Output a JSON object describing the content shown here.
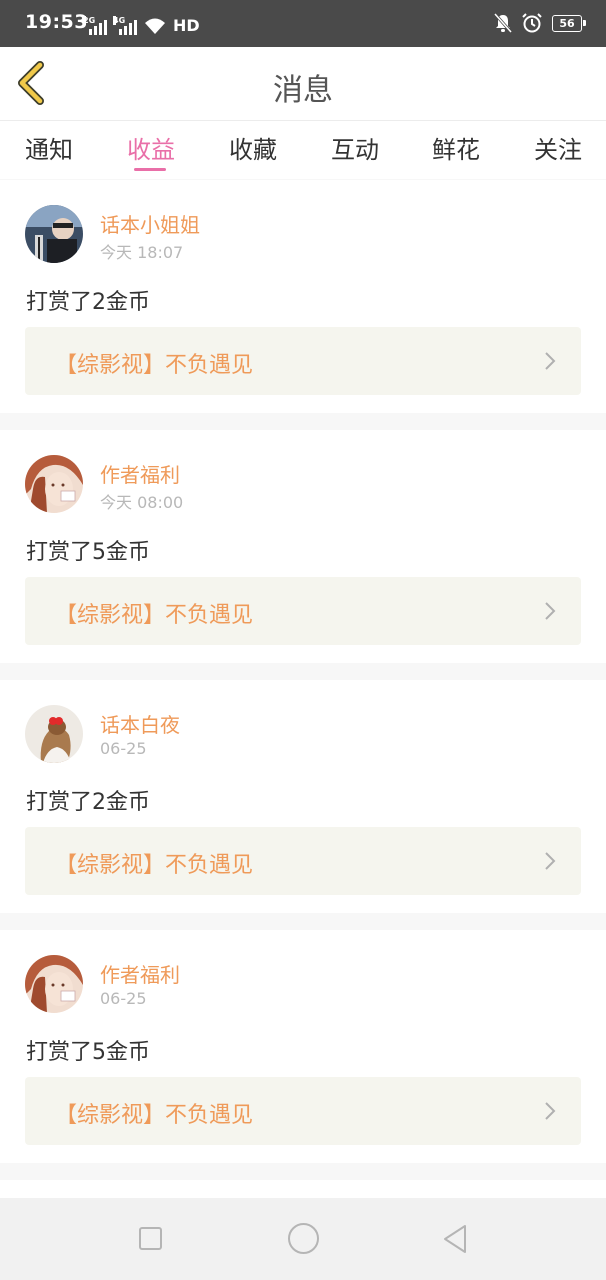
{
  "status_bar": {
    "time": "19:53",
    "network_1": "2G",
    "network_2": "4G",
    "hd": "HD",
    "battery": "56"
  },
  "header": {
    "title": "消息"
  },
  "tabs": [
    {
      "label": "通知",
      "active": false
    },
    {
      "label": "收益",
      "active": true
    },
    {
      "label": "收藏",
      "active": false
    },
    {
      "label": "互动",
      "active": false
    },
    {
      "label": "鲜花",
      "active": false
    },
    {
      "label": "关注",
      "active": false
    }
  ],
  "messages": [
    {
      "sender": "话本小姐姐",
      "time": "今天 18:07",
      "text": "打赏了2金币",
      "book": "【综影视】不负遇见"
    },
    {
      "sender": "作者福利",
      "time": "今天 08:00",
      "text": "打赏了5金币",
      "book": "【综影视】不负遇见"
    },
    {
      "sender": "话本白夜",
      "time": "06-25",
      "text": "打赏了2金币",
      "book": "【综影视】不负遇见"
    },
    {
      "sender": "作者福利",
      "time": "06-25",
      "text": "打赏了5金币",
      "book": "【综影视】不负遇见"
    }
  ],
  "colors": {
    "accent_pink": "#e96fa8",
    "accent_orange": "#ef9a59",
    "back_arrow": "#f0c94a"
  },
  "icons": {
    "back": "back-arrow-icon",
    "chevron": "chevron-right-icon",
    "nav_recent": "square-icon",
    "nav_home": "circle-icon",
    "nav_back": "triangle-back-icon"
  }
}
